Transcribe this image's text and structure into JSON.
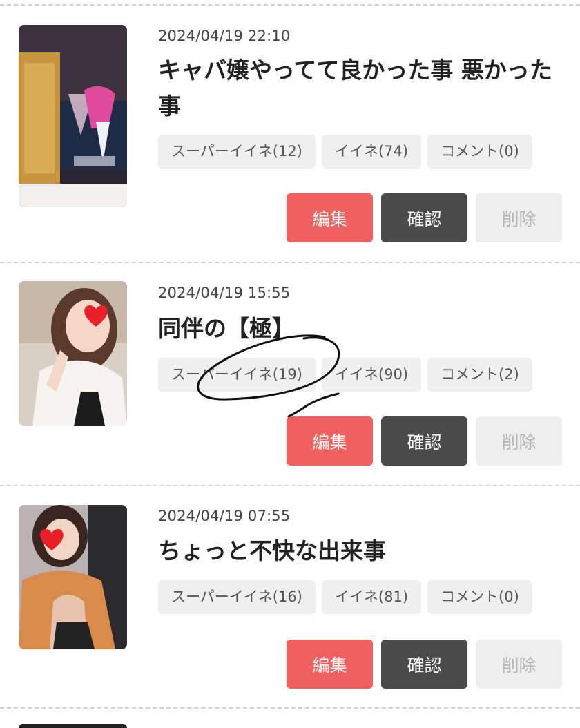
{
  "posts": [
    {
      "date": "2024/04/19 22:10",
      "title": "キャバ嬢やってて良かった事 悪かった事",
      "super_like": "スーパーイイネ(12)",
      "like": "イイネ(74)",
      "comment": "コメント(0)",
      "edit_label": "編集",
      "confirm_label": "確認",
      "delete_label": "削除"
    },
    {
      "date": "2024/04/19 15:55",
      "title": "同伴の【極】",
      "super_like": "スーパーイイネ(19)",
      "like": "イイネ(90)",
      "comment": "コメント(2)",
      "edit_label": "編集",
      "confirm_label": "確認",
      "delete_label": "削除"
    },
    {
      "date": "2024/04/19 07:55",
      "title": "ちょっと不快な出来事",
      "super_like": "スーパーイイネ(16)",
      "like": "イイネ(81)",
      "comment": "コメント(0)",
      "edit_label": "編集",
      "confirm_label": "確認",
      "delete_label": "削除"
    }
  ],
  "colors": {
    "edit": "#f0605e",
    "confirm": "#4a4a4a",
    "delete_bg": "#eeeeee",
    "stat_bg": "#efefef",
    "divider": "#d0d0d0"
  }
}
